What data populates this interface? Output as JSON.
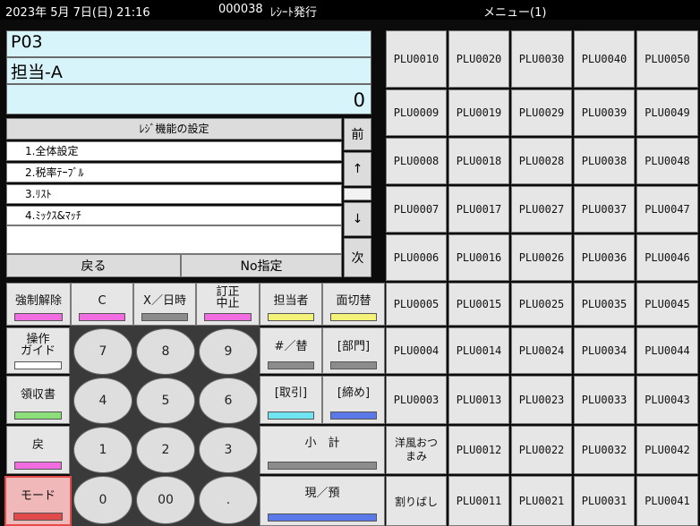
{
  "status": {
    "datetime": "2023年 5月 7日(日) 21:16",
    "receipt_no": "000038",
    "issue": "ﾚｼｰﾄ発行",
    "menu": "メニュー(1)"
  },
  "display": {
    "code": "P03",
    "clerk": "担当-A",
    "amount": "0"
  },
  "menu": {
    "header": "ﾚｼﾞ機能の設定",
    "items": [
      "1.全体設定",
      "2.税率ﾃｰﾌﾞﾙ",
      "3.ﾘｽﾄ",
      "4.ﾐｯｸｽ&ﾏｯﾁ"
    ],
    "back": "戻る",
    "no_spec": "No指定",
    "prev": "前",
    "up": "↑",
    "down": "↓",
    "next": "次"
  },
  "func": {
    "cancel_force": "強制解除",
    "clear": "C",
    "x_datetime": "X／日時",
    "void_top": "訂正",
    "void_bottom": "中止",
    "clerk": "担当者",
    "face_switch": "面切替",
    "guide_top": "操作",
    "guide_bottom": "ガイド",
    "hash": "#／替",
    "dept": "[部門]",
    "receipt": "領収書",
    "transaction": "[取引]",
    "close": "[締め]",
    "return": "戻",
    "subtotal": "小　計",
    "mode": "モード",
    "cash": "現／預"
  },
  "numpad": [
    "7",
    "8",
    "9",
    "4",
    "5",
    "6",
    "1",
    "2",
    "3",
    "0",
    "00",
    "."
  ],
  "plu_grid": [
    [
      "PLU0010",
      "PLU0020",
      "PLU0030",
      "PLU0040",
      "PLU0050"
    ],
    [
      "PLU0009",
      "PLU0019",
      "PLU0029",
      "PLU0039",
      "PLU0049"
    ],
    [
      "PLU0008",
      "PLU0018",
      "PLU0028",
      "PLU0038",
      "PLU0048"
    ],
    [
      "PLU0007",
      "PLU0017",
      "PLU0027",
      "PLU0037",
      "PLU0047"
    ],
    [
      "PLU0006",
      "PLU0016",
      "PLU0026",
      "PLU0036",
      "PLU0046"
    ],
    [
      "PLU0005",
      "PLU0015",
      "PLU0025",
      "PLU0035",
      "PLU0045"
    ],
    [
      "PLU0004",
      "PLU0014",
      "PLU0024",
      "PLU0034",
      "PLU0044"
    ],
    [
      "PLU0003",
      "PLU0013",
      "PLU0023",
      "PLU0033",
      "PLU0043"
    ],
    [
      "洋風おつまみ",
      "PLU0012",
      "PLU0022",
      "PLU0032",
      "PLU0042"
    ],
    [
      "割りばし",
      "PLU0011",
      "PLU0021",
      "PLU0031",
      "PLU0041"
    ]
  ],
  "colors": {
    "pink": "#f06ce0",
    "gray": "#8c8c8c",
    "yellow": "#f5f27a",
    "blue": "#5a78e8",
    "cyan": "#6fe3f0",
    "green": "#8be07a",
    "red": "#e34a4a"
  }
}
